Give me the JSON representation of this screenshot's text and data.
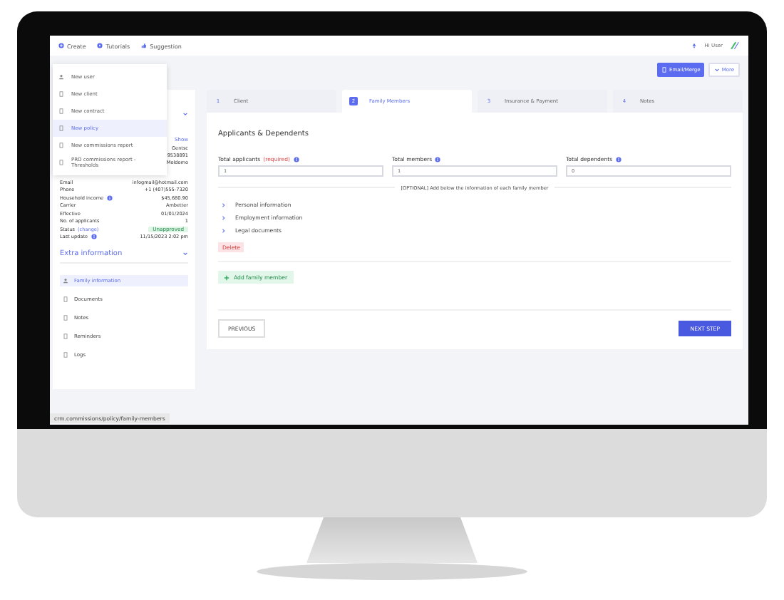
{
  "top_nav": {
    "items": [
      {
        "label": "Create"
      },
      {
        "label": "Tutorials"
      },
      {
        "label": "Suggestion"
      }
    ],
    "greeting": "Hi User"
  },
  "actions": [
    {
      "label": "Email/Merge",
      "kind": "primary"
    },
    {
      "label": "More",
      "kind": "secondary"
    }
  ],
  "create_menu": [
    {
      "label": "New user",
      "selected": false
    },
    {
      "label": "New client",
      "selected": false
    },
    {
      "label": "New contract",
      "selected": false
    },
    {
      "label": "New policy",
      "selected": true
    },
    {
      "label": "New commissions report",
      "selected": false
    },
    {
      "label": "PRO commissions report - Thresholds",
      "selected": false
    }
  ],
  "client_panel": {
    "show_link": "Show",
    "hidden_values": [
      "Gentsc",
      "9538891",
      "Moldomo"
    ],
    "fields": [
      {
        "label": "Email",
        "value": "infogmail@hotmail.com",
        "kind": "text"
      },
      {
        "label": "Phone",
        "value": "+1 (407)555-7320",
        "kind": "text"
      },
      {
        "label": "Household income",
        "value": "$45,680.90",
        "kind": "info"
      },
      {
        "label": "Carrier",
        "value": "Ambetter",
        "kind": "text"
      },
      {
        "label": "Effective",
        "value": "01/01/2024",
        "kind": "text"
      },
      {
        "label": "No. of applicants",
        "value": "1",
        "kind": "text"
      },
      {
        "label": "Status",
        "link": "(change)",
        "value": "Unapproved",
        "kind": "status"
      },
      {
        "label": "Last update",
        "value": "11/15/2023 2:02 pm",
        "kind": "info"
      }
    ]
  },
  "extra_information": {
    "title": "Extra information",
    "items": [
      {
        "label": "Family information",
        "selected": true
      },
      {
        "label": "Documents",
        "selected": false
      },
      {
        "label": "Notes",
        "selected": false
      },
      {
        "label": "Reminders",
        "selected": false
      },
      {
        "label": "Logs",
        "selected": false
      }
    ]
  },
  "steps": [
    {
      "number": "1",
      "label": "Client",
      "selected": false
    },
    {
      "number": "2",
      "label": "Family Members",
      "selected": true
    },
    {
      "number": "3",
      "label": "Insurance & Payment",
      "selected": false
    },
    {
      "number": "4",
      "label": "Notes",
      "selected": false
    }
  ],
  "form": {
    "title": "Applicants & Dependents",
    "fields": [
      {
        "label": "Total applicants",
        "required_note": "(required)",
        "value": "1"
      },
      {
        "label": "Total members",
        "value": "1"
      },
      {
        "label": "Total dependents",
        "value": "0"
      }
    ],
    "divider": "[OPTIONAL] Add below the information of each family member",
    "sections": [
      {
        "label": "Personal information",
        "expanded": false
      },
      {
        "label": "Employment information",
        "expanded": false
      },
      {
        "label": "Legal documents",
        "expanded": false
      }
    ],
    "delete_button": "Delete",
    "add_button": "Add family member",
    "previous_button": "PREVIOUS",
    "next_button": "NEXT STEP"
  },
  "status_url": "crm.commissions/policy/family-members"
}
